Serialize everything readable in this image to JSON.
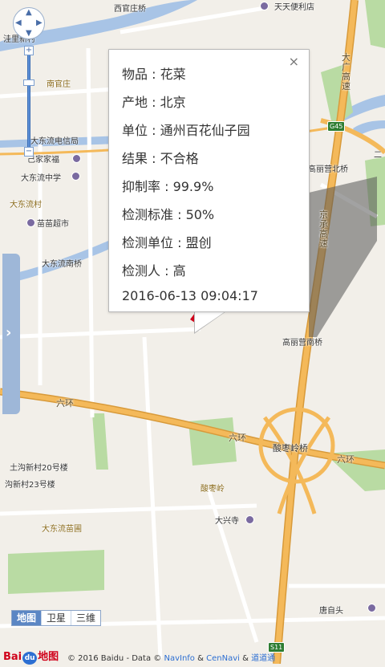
{
  "map": {
    "labels": {
      "xiguanzhuang_bridge": "西官庄桥",
      "tiantian_store": "天天便利店",
      "wadian_new_village": "洼里新村",
      "nanguanzhuang": "南官庄",
      "dadongliu_telecom": "大东流电信局",
      "jiajiafu": "己家家福",
      "dadongliu_middle_school": "大东流中学",
      "dadongliu_village": "大东流村",
      "miaomiao_supermarket": "苗苗超市",
      "dadongliu_south_bridge": "大东流南桥",
      "gaoliying_north_bridge": "高丽营北桥",
      "gaoliying_south_bridge": "高丽营南桥",
      "jingcheng_expressway": "京承高速",
      "dachang_expressway": "大广高速",
      "sixth_ring_left": "六环",
      "sixth_ring_mid": "六环",
      "sixth_ring_right": "六环",
      "suanzaoling_bridge": "酸枣岭桥",
      "suanzaoling": "酸枣岭",
      "daxing_temple": "大兴寺",
      "tugou_20": "土沟新村20号楼",
      "tugou_23": "沟新村23号楼",
      "dadongliu_nursery": "大东流苗圃",
      "tangbaitou": "唐自头",
      "erqi": "二",
      "g45": "G45",
      "s11": "S11"
    },
    "colors": {
      "background": "#f2efe9",
      "water": "#a8c4e6",
      "green": "#b9dba3",
      "highway": "#f4b95a",
      "highway_edge": "#d89a3a",
      "road": "#ffffff"
    },
    "marker_color": "#d0021b"
  },
  "popup": {
    "rows": [
      "物品 : 花菜",
      "产地 : 北京",
      "单位 : 通州百花仙子园",
      "结果 : 不合格",
      "抑制率 : 99.9%",
      "检测标准 : 50%",
      "检测单位 : 盟创",
      "检测人 : 高",
      "2016-06-13 09:04:17"
    ],
    "close": "×"
  },
  "controls": {
    "nav_arrows": {
      "up": "▲",
      "down": "▼",
      "left": "◀",
      "right": "▶"
    },
    "zoom_in": "+",
    "zoom_out": "−",
    "side_tab_arrow": "›",
    "map_types": [
      "地图",
      "卫星",
      "三维"
    ],
    "active_map_type": "地图"
  },
  "footer": {
    "logo_left": "Bai",
    "logo_du": "du",
    "logo_right": "地图",
    "copyright_prefix": "© 2016 Baidu - Data ©",
    "navinfo": "NavInfo",
    "amp1": "&",
    "cennavi": "CenNavi",
    "amp2": "&",
    "daodaotong": "道道通"
  }
}
